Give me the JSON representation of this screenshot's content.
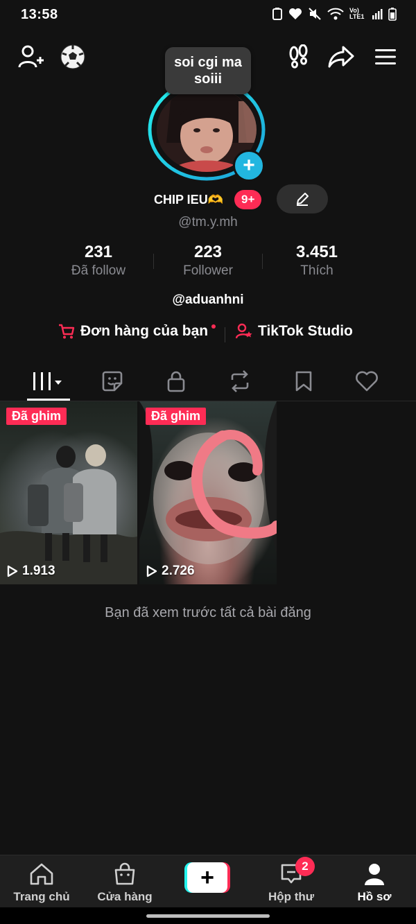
{
  "status_bar": {
    "time": "13:58",
    "network": "Vo) LTE1"
  },
  "top_bar": {
    "icons": [
      "add-friend-icon",
      "soccer-ball-icon",
      "footprints-icon",
      "share-icon",
      "menu-icon"
    ]
  },
  "profile": {
    "note_bubble": "soi cgi ma soiii",
    "display_name": "CHIP IEU🫶",
    "notification_badge": "9+",
    "username": "@tm.y.mh",
    "bio": "@aduanhni"
  },
  "stats": [
    {
      "value": "231",
      "label": "Đã follow"
    },
    {
      "value": "223",
      "label": "Follower"
    },
    {
      "value": "3.451",
      "label": "Thích"
    }
  ],
  "links": {
    "orders": "Đơn hàng của bạn",
    "studio": "TikTok Studio"
  },
  "tabs": [
    "videos-grid-icon",
    "sticker-icon",
    "lock-icon",
    "repost-icon",
    "bookmark-icon",
    "heart-icon"
  ],
  "videos": [
    {
      "pinned_label": "Đã ghim",
      "views": "1.913"
    },
    {
      "pinned_label": "Đã ghim",
      "views": "2.726"
    }
  ],
  "end_note": "Bạn đã xem trước tất cả bài đăng",
  "bottom_nav": {
    "home": "Trang chủ",
    "shop": "Cửa hàng",
    "inbox": "Hộp thư",
    "inbox_badge": "2",
    "profile": "Hồ sơ"
  },
  "colors": {
    "background": "#121212",
    "accent_red": "#fe2c55",
    "accent_cyan": "#25f4ee",
    "ring_blue": "#22b6e0",
    "muted_text": "#8a8b91"
  }
}
